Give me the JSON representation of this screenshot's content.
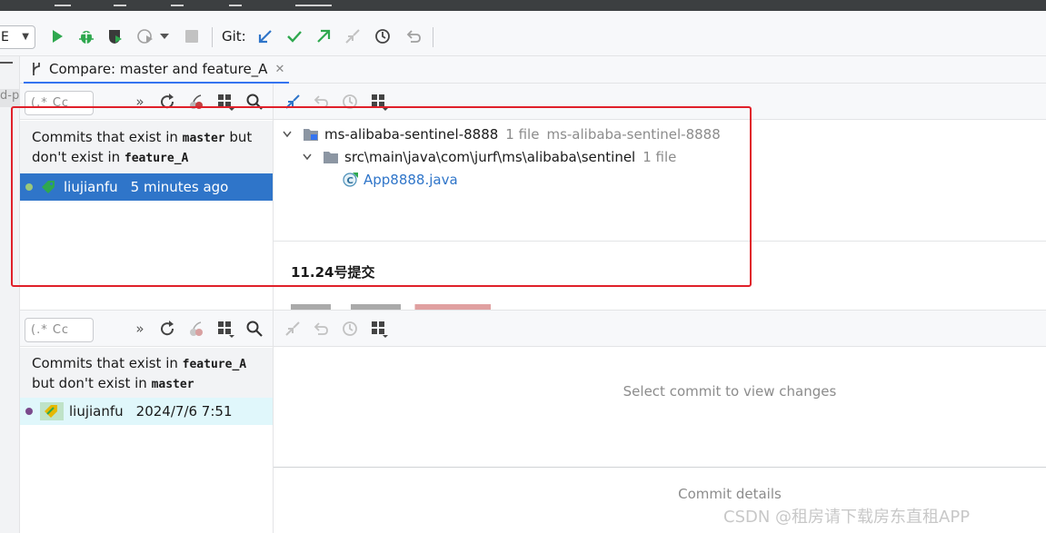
{
  "toolbar": {
    "run_config": "E",
    "git_label": "Git:",
    "icons": [
      "run-icon",
      "debug-icon",
      "coverage-icon",
      "profile-icon",
      "stop-icon",
      "git-update-icon",
      "git-commit-icon",
      "git-push-icon",
      "git-merge-icon",
      "git-history-icon",
      "git-rollback-icon"
    ]
  },
  "left_gutter": {
    "clip_text": "d-p"
  },
  "tab": {
    "title": "Compare: master and feature_A",
    "close": "✕"
  },
  "upper": {
    "search_placeholder": "(.* Cc",
    "header_pre1": "Commits that exist in ",
    "header_branch1": "master",
    "header_mid1": " but",
    "header_pre2": "don't exist in ",
    "header_branch2": "feature_A",
    "commit": {
      "author": "liujianfu",
      "time": "5 minutes ago"
    },
    "tree": {
      "module": "ms-alibaba-sentinel-8888",
      "module_count": "1 file",
      "module_path": "ms-alibaba-sentinel-8888",
      "package": "src\\main\\java\\com\\jurf\\ms\\alibaba\\sentinel",
      "package_count": "1 file",
      "file": "App8888.java"
    },
    "commit_message": "11.24号提交"
  },
  "lower": {
    "search_placeholder": "(.* Cc",
    "header_pre1": "Commits that exist in ",
    "header_branch1": "feature_A",
    "header_pre2": "but don't exist in ",
    "header_branch2": "master",
    "commit": {
      "author": "liujianfu",
      "time": "2024/7/6 7:51"
    },
    "empty_changes": "Select commit to view changes",
    "empty_details": "Commit details"
  },
  "watermark": "CSDN @租房请下载房东直租APP",
  "colors": {
    "accent": "#2f75c9",
    "highlight_box": "#e0202a",
    "green": "#2fa84f",
    "tag_yellow": "#e6b800"
  }
}
